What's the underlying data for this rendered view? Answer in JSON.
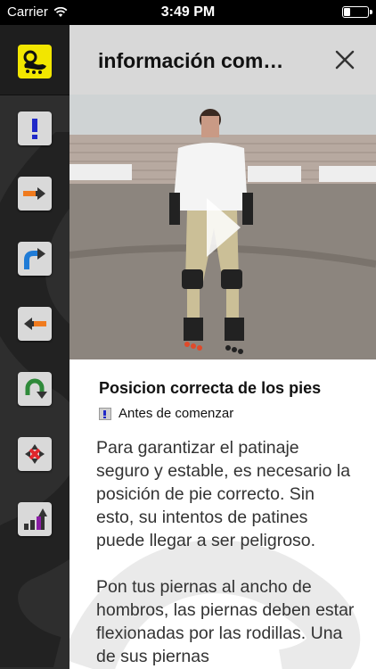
{
  "status_bar": {
    "carrier": "Carrier",
    "time": "3:49 PM"
  },
  "sidebar": {
    "items": [
      {
        "name": "logo",
        "icon": "skater-logo-icon"
      },
      {
        "name": "before-start",
        "icon": "exclamation-icon"
      },
      {
        "name": "forward",
        "icon": "arrow-right-icon"
      },
      {
        "name": "turn",
        "icon": "curved-arrow-icon"
      },
      {
        "name": "backward",
        "icon": "arrow-left-icon"
      },
      {
        "name": "u-turn",
        "icon": "u-turn-icon"
      },
      {
        "name": "stop",
        "icon": "stop-x-icon"
      },
      {
        "name": "advanced",
        "icon": "bar-chart-up-icon"
      }
    ]
  },
  "header": {
    "title": "información com…"
  },
  "video": {
    "play_icon": "play-icon"
  },
  "content": {
    "title": "Posicion correcta de los pies",
    "category": "Antes de comenzar",
    "paragraphs": [
      "Para garantizar el patinaje seguro y estable, es necesario la posición de pie correcto. Sin esto, su intentos de patines puede llegar a ser peligroso.",
      "Pon tus piernas al ancho de hombros, las piernas deben estar flexionadas por las rodillas. Una de sus piernas"
    ]
  },
  "colors": {
    "accent_yellow": "#f2e600",
    "header_gray": "#d8d8d8",
    "sidebar_bg": "#2e2e2e",
    "icon_blue": "#2029c8",
    "icon_orange": "#f07b1e",
    "icon_green": "#2f8a3a",
    "icon_red": "#e0262c",
    "icon_purple": "#8a1ea5"
  }
}
